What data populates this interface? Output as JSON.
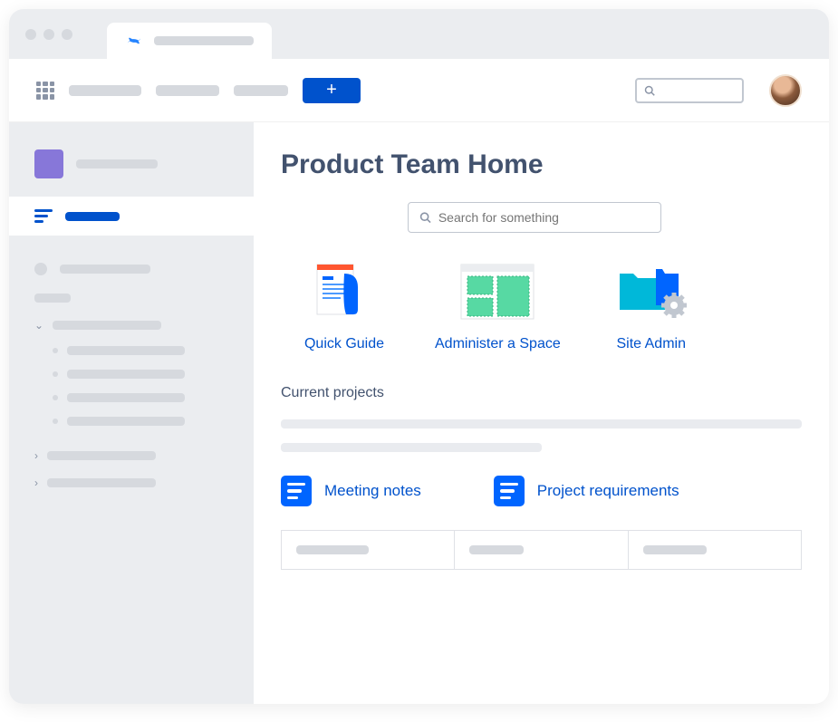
{
  "header": {
    "create_label": "+"
  },
  "search": {
    "placeholder": "Search for something"
  },
  "page": {
    "title": "Product Team Home"
  },
  "cards": [
    {
      "label": "Quick Guide"
    },
    {
      "label": "Administer a Space"
    },
    {
      "label": "Site Admin"
    }
  ],
  "sections": {
    "current_projects": "Current projects"
  },
  "links": [
    {
      "label": "Meeting notes"
    },
    {
      "label": "Project requirements"
    }
  ]
}
